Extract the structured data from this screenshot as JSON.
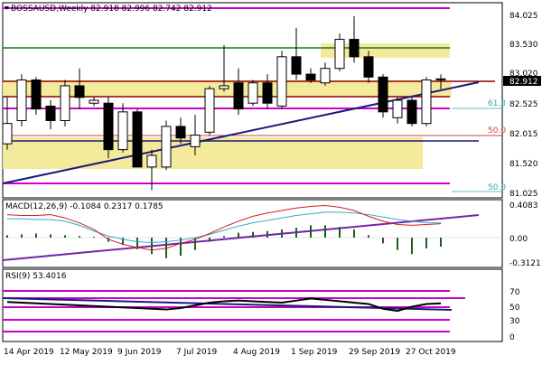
{
  "chart_data": [
    {
      "type": "candlestick",
      "panel": "price",
      "title": "BOSSAUSD,Weekly  82.918 82.996 82.742 82.912",
      "last_price": "82.912",
      "ylim": [
        80.9,
        84.2
      ],
      "y_ticks": [
        "84.025",
        "83.530",
        "83.020",
        "82.525",
        "82.015",
        "81.520",
        "81.025"
      ],
      "fib_labels": [
        {
          "text": "61.8",
          "y": 82.52
        },
        {
          "text": "50.0",
          "y": 82.1
        },
        {
          "text": "50.0",
          "y": 81.1
        }
      ],
      "candles": [
        {
          "o": 81.8,
          "h": 82.6,
          "l": 81.7,
          "c": 82.15
        },
        {
          "o": 82.2,
          "h": 83.0,
          "l": 82.1,
          "c": 82.9
        },
        {
          "o": 82.9,
          "h": 82.95,
          "l": 82.3,
          "c": 82.4
        },
        {
          "o": 82.45,
          "h": 82.55,
          "l": 82.05,
          "c": 82.2
        },
        {
          "o": 82.2,
          "h": 82.9,
          "l": 82.1,
          "c": 82.8
        },
        {
          "o": 82.8,
          "h": 83.1,
          "l": 82.4,
          "c": 82.6
        },
        {
          "o": 82.5,
          "h": 82.6,
          "l": 82.45,
          "c": 82.55
        },
        {
          "o": 82.5,
          "h": 82.6,
          "l": 81.55,
          "c": 81.7
        },
        {
          "o": 81.7,
          "h": 82.5,
          "l": 81.65,
          "c": 82.35
        },
        {
          "o": 82.35,
          "h": 82.4,
          "l": 81.5,
          "c": 81.4
        },
        {
          "o": 81.4,
          "h": 81.7,
          "l": 81.0,
          "c": 81.6
        },
        {
          "o": 81.4,
          "h": 82.2,
          "l": 81.35,
          "c": 82.1
        },
        {
          "o": 82.1,
          "h": 82.25,
          "l": 81.8,
          "c": 81.9
        },
        {
          "o": 81.75,
          "h": 82.3,
          "l": 81.6,
          "c": 81.95
        },
        {
          "o": 82.0,
          "h": 82.8,
          "l": 81.95,
          "c": 82.75
        },
        {
          "o": 82.75,
          "h": 83.5,
          "l": 82.7,
          "c": 82.8
        },
        {
          "o": 82.85,
          "h": 83.1,
          "l": 82.3,
          "c": 82.4
        },
        {
          "o": 82.5,
          "h": 82.9,
          "l": 82.45,
          "c": 82.85
        },
        {
          "o": 82.85,
          "h": 83.0,
          "l": 82.4,
          "c": 82.5
        },
        {
          "o": 82.45,
          "h": 83.4,
          "l": 82.4,
          "c": 83.3
        },
        {
          "o": 83.3,
          "h": 83.8,
          "l": 82.9,
          "c": 83.0
        },
        {
          "o": 83.0,
          "h": 83.1,
          "l": 82.85,
          "c": 82.9
        },
        {
          "o": 82.85,
          "h": 83.2,
          "l": 82.8,
          "c": 83.1
        },
        {
          "o": 83.1,
          "h": 83.7,
          "l": 83.05,
          "c": 83.6
        },
        {
          "o": 83.6,
          "h": 84.0,
          "l": 83.2,
          "c": 83.3
        },
        {
          "o": 83.3,
          "h": 83.4,
          "l": 82.85,
          "c": 82.95
        },
        {
          "o": 82.95,
          "h": 83.0,
          "l": 82.25,
          "c": 82.35
        },
        {
          "o": 82.25,
          "h": 82.6,
          "l": 82.15,
          "c": 82.55
        },
        {
          "o": 82.55,
          "h": 82.6,
          "l": 82.1,
          "c": 82.15
        },
        {
          "o": 82.15,
          "h": 82.95,
          "l": 82.1,
          "c": 82.9
        },
        {
          "o": 82.918,
          "h": 82.996,
          "l": 82.742,
          "c": 82.912
        }
      ]
    },
    {
      "type": "bar",
      "panel": "macd",
      "title": "MACD(12,26,9) -0.1084 0.2317 0.1785",
      "ylim": [
        -0.34,
        0.44
      ],
      "y_ticks": [
        "0.4083",
        "0.00",
        "-0.3121"
      ],
      "histogram": [
        0.03,
        0.04,
        0.05,
        0.04,
        0.03,
        0.02,
        0.01,
        -0.05,
        -0.09,
        -0.14,
        -0.2,
        -0.25,
        -0.22,
        -0.15,
        -0.05,
        0.02,
        0.06,
        0.07,
        0.08,
        0.1,
        0.12,
        0.15,
        0.15,
        0.13,
        0.1,
        0.03,
        -0.07,
        -0.15,
        -0.2,
        -0.13,
        -0.11
      ],
      "signal": [
        0.23,
        0.23,
        0.22,
        0.22,
        0.2,
        0.15,
        0.08,
        0.02,
        -0.02,
        -0.05,
        -0.06,
        -0.05,
        -0.03,
        0.0,
        0.04,
        0.09,
        0.14,
        0.18,
        0.21,
        0.24,
        0.27,
        0.29,
        0.31,
        0.31,
        0.3,
        0.28,
        0.25,
        0.22,
        0.2,
        0.18,
        0.18
      ],
      "macd_line": [
        0.28,
        0.27,
        0.27,
        0.28,
        0.24,
        0.18,
        0.1,
        -0.02,
        -0.08,
        -0.12,
        -0.15,
        -0.13,
        -0.07,
        -0.02,
        0.05,
        0.13,
        0.2,
        0.26,
        0.3,
        0.33,
        0.36,
        0.38,
        0.39,
        0.37,
        0.33,
        0.26,
        0.2,
        0.16,
        0.15,
        0.16,
        0.17
      ]
    },
    {
      "type": "line",
      "panel": "rsi",
      "title": "RSI(9) 53.4016",
      "ylim": [
        0,
        100
      ],
      "y_ticks": [
        "70",
        "50",
        "30",
        "0"
      ],
      "values": [
        55,
        54,
        53,
        52,
        51,
        50,
        49,
        48,
        47,
        46,
        45,
        44,
        46,
        50,
        54,
        56,
        57,
        56,
        55,
        54,
        57,
        60,
        58,
        56,
        54,
        52,
        45,
        42,
        48,
        52,
        53
      ]
    }
  ],
  "x_labels": [
    "14 Apr 2019",
    "12 May 2019",
    "9 Jun 2019",
    "7 Jul 2019",
    "4 Aug 2019",
    "1 Sep 2019",
    "29 Sep 2019",
    "27 Oct 2019"
  ],
  "colors": {
    "bull_candle": "#ffffff",
    "bear_candle": "#000000",
    "zone_fill": "#f4ea9c",
    "trendline": "#1a1a7a",
    "magenta": "#cc00cc",
    "dark_red": "#8b0000",
    "green": "#1a7a1a",
    "signal": "#33aacc",
    "macd": "#cc2222",
    "histogram": "#1b5e20"
  }
}
